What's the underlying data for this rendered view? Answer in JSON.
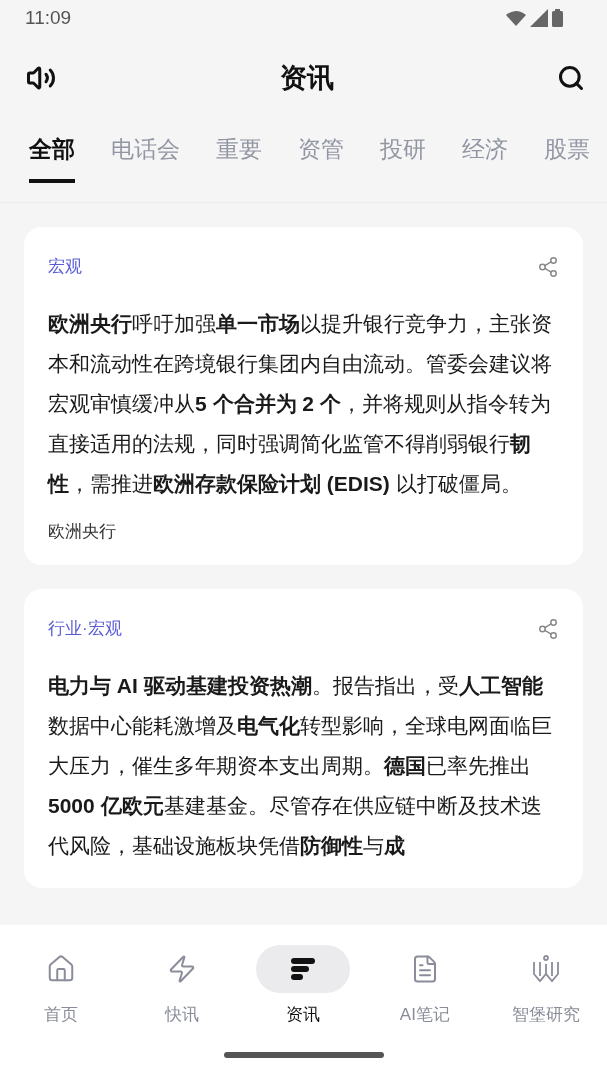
{
  "status_bar": {
    "time": "11:09"
  },
  "header": {
    "title": "资讯"
  },
  "tabs": [
    {
      "label": "全部",
      "selected": true
    },
    {
      "label": "电话会",
      "selected": false
    },
    {
      "label": "重要",
      "selected": false
    },
    {
      "label": "资管",
      "selected": false
    },
    {
      "label": "投研",
      "selected": false
    },
    {
      "label": "经济",
      "selected": false
    },
    {
      "label": "股票",
      "selected": false
    }
  ],
  "articles": [
    {
      "category": "宏观",
      "body": "**欧洲央行**呼吁加强**单一市场**以提升银行竞争力，主张资本和流动性在跨境银行集团内自由流动。管委会建议将宏观审慎缓冲从**5 个合并为 2 个**，并将规则从指令转为直接适用的法规，同时强调简化监管不得削弱银行**韧性**，需推进**欧洲存款保险计划 (EDIS)** 以打破僵局。",
      "source": "欧洲央行"
    },
    {
      "category": "行业·宏观",
      "body": "**电力与 AI 驱动基建投资热潮**。报告指出，受**人工智能**数据中心能耗激增及**电气化**转型影响，全球电网面临巨大压力，催生多年期资本支出周期。**德国**已率先推出**5000 亿欧元**基建基金。尽管存在供应链中断及技术迭代风险，基础设施板块凭借**防御性**与**成**"
    }
  ],
  "bottom_nav": [
    {
      "kind": "home",
      "label": "首页",
      "selected": false
    },
    {
      "kind": "flash",
      "label": "快讯",
      "selected": false
    },
    {
      "kind": "news",
      "label": "资讯",
      "selected": true
    },
    {
      "kind": "notes",
      "label": "AI笔记",
      "selected": false
    },
    {
      "kind": "research",
      "label": "智堡研究",
      "selected": false
    }
  ]
}
